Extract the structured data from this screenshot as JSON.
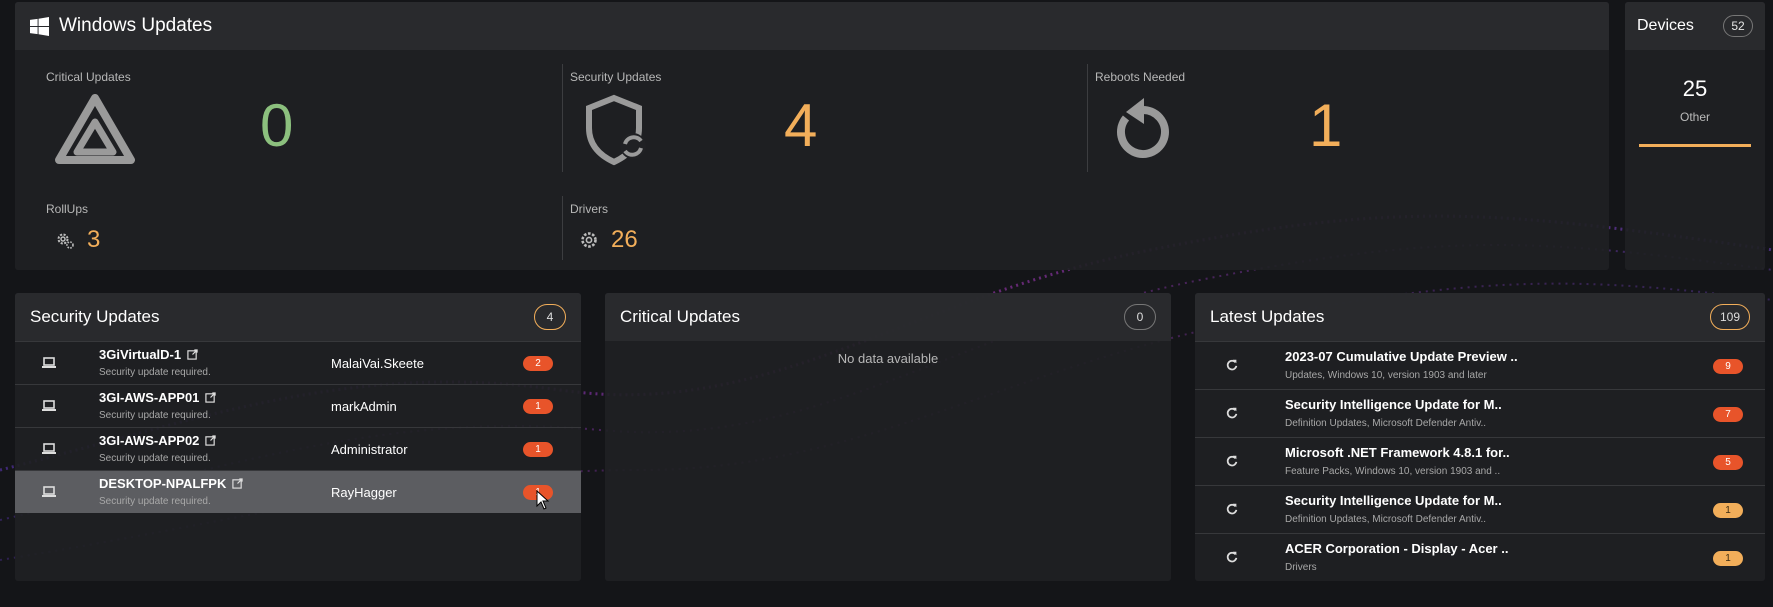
{
  "windows_updates": {
    "title": "Windows Updates",
    "critical": {
      "label": "Critical Updates",
      "value": "0",
      "color": "#8cc07e"
    },
    "security": {
      "label": "Security Updates",
      "value": "4",
      "color": "#f2ae5a"
    },
    "reboots": {
      "label": "Reboots Needed",
      "value": "1",
      "color": "#f2ae5a"
    },
    "rollups": {
      "label": "RollUps",
      "value": "3"
    },
    "drivers": {
      "label": "Drivers",
      "value": "26"
    }
  },
  "devices": {
    "title": "Devices",
    "count": "52",
    "number": "25",
    "sublabel": "Other"
  },
  "security_panel": {
    "title": "Security Updates",
    "count": "4",
    "rows": [
      {
        "device": "3GiVirtualD-1",
        "status": "Security update required.",
        "user": "MalaiVai.Skeete",
        "count": "2"
      },
      {
        "device": "3GI-AWS-APP01",
        "status": "Security update required.",
        "user": "markAdmin",
        "count": "1"
      },
      {
        "device": "3GI-AWS-APP02",
        "status": "Security update required.",
        "user": "Administrator",
        "count": "1"
      },
      {
        "device": "DESKTOP-NPALFPK",
        "status": "Security update required.",
        "user": "RayHagger",
        "count": "1"
      }
    ]
  },
  "critical_panel": {
    "title": "Critical Updates",
    "count": "0",
    "empty_text": "No data available"
  },
  "latest_panel": {
    "title": "Latest Updates",
    "count": "109",
    "rows": [
      {
        "title": "2023-07 Cumulative Update Preview ..",
        "sub": "Updates, Windows 10, version 1903 and later",
        "count": "9",
        "badge": "red"
      },
      {
        "title": "Security Intelligence Update for M..",
        "sub": "Definition Updates, Microsoft Defender Antiv..",
        "count": "7",
        "badge": "red"
      },
      {
        "title": "Microsoft .NET Framework 4.8.1 for..",
        "sub": "Feature Packs, Windows 10, version 1903 and ..",
        "count": "5",
        "badge": "red"
      },
      {
        "title": "Security Intelligence Update for M..",
        "sub": "Definition Updates, Microsoft Defender Antiv..",
        "count": "1",
        "badge": "yellow"
      },
      {
        "title": "ACER Corporation - Display - Acer ..",
        "sub": "Drivers",
        "count": "1",
        "badge": "yellow"
      }
    ]
  }
}
